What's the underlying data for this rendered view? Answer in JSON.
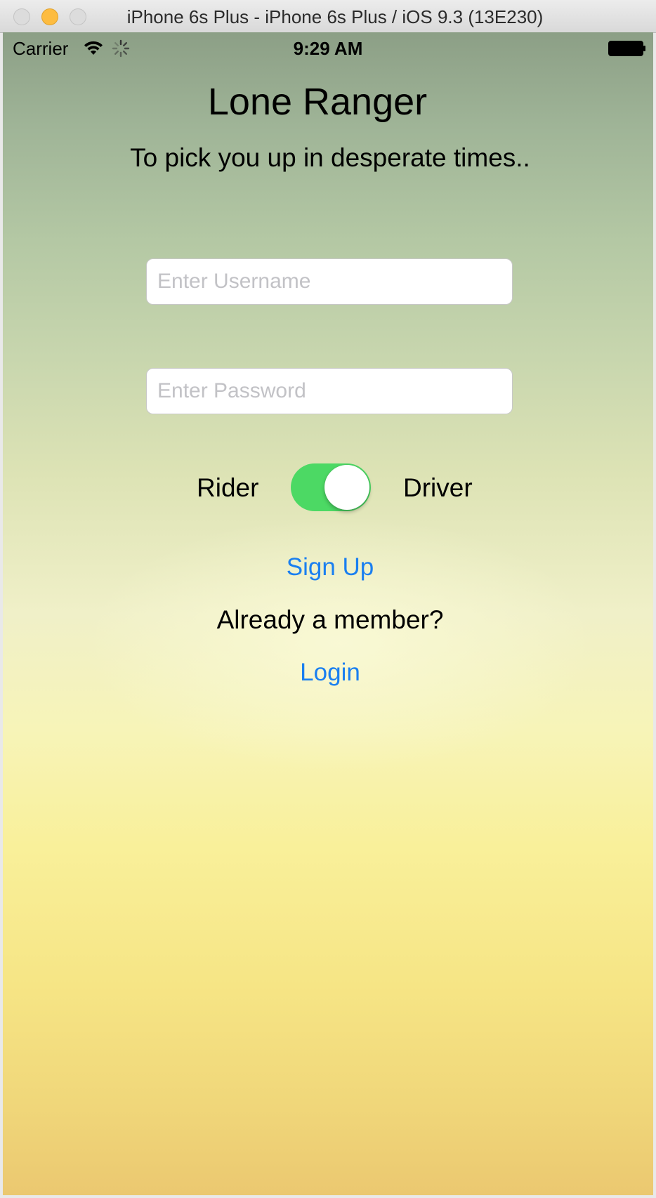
{
  "window": {
    "title": "iPhone 6s Plus - iPhone 6s Plus / iOS 9.3 (13E230)"
  },
  "status_bar": {
    "carrier": "Carrier",
    "time": "9:29 AM",
    "icons": [
      "wifi-icon",
      "activity-icon",
      "battery-icon"
    ]
  },
  "app": {
    "title": "Lone Ranger",
    "subtitle": "To pick you up in desperate times.."
  },
  "form": {
    "username_placeholder": "Enter Username",
    "username_value": "",
    "password_placeholder": "Enter Password",
    "password_value": ""
  },
  "role": {
    "left_label": "Rider",
    "right_label": "Driver",
    "switch_on": true,
    "switch_on_color": "#4cd964"
  },
  "actions": {
    "signup_label": "Sign Up",
    "member_prompt": "Already a member?",
    "login_label": "Login",
    "link_color": "#1a7ff0"
  }
}
